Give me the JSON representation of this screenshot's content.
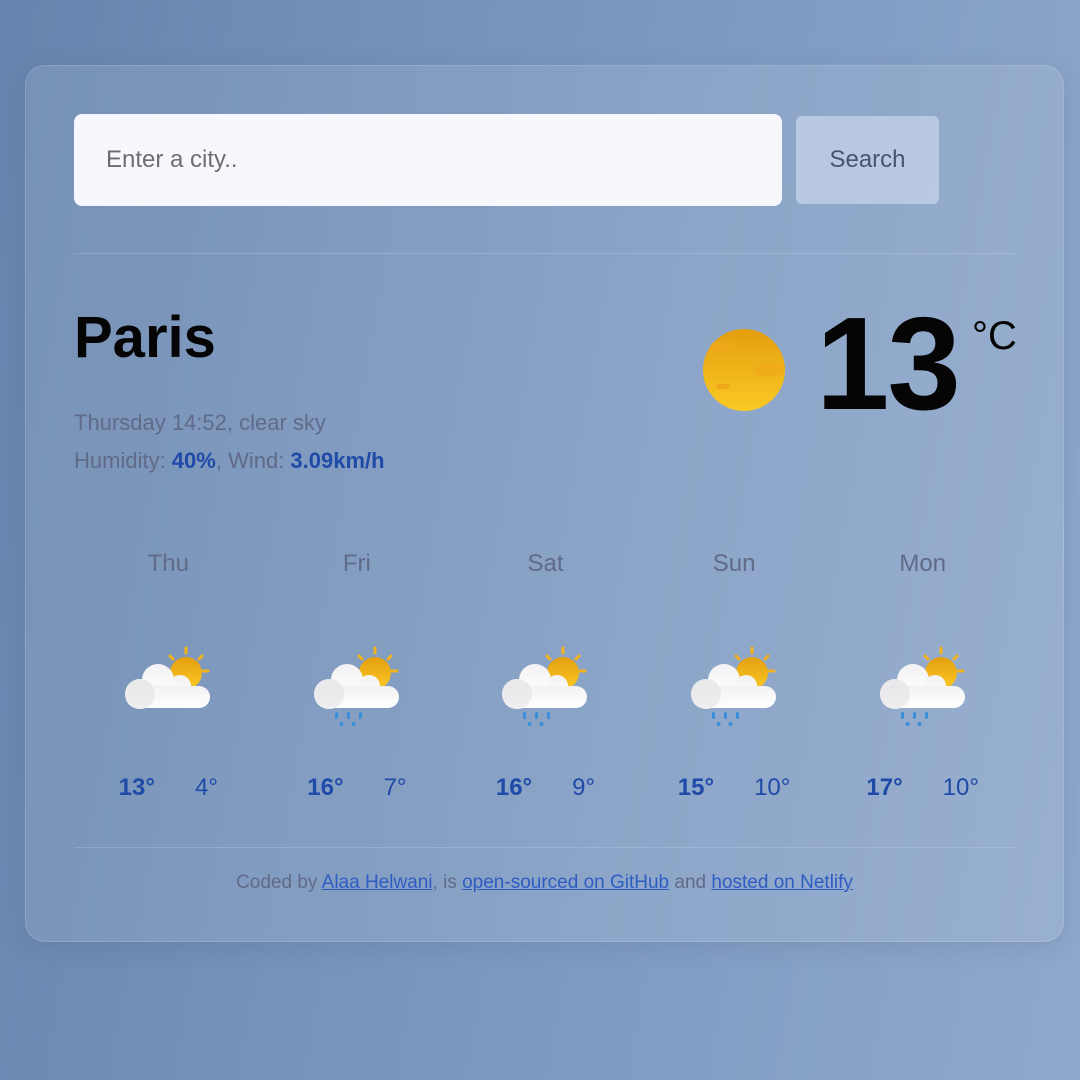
{
  "search": {
    "placeholder": "Enter a city..",
    "value": "",
    "button_label": "Search"
  },
  "current": {
    "city": "Paris",
    "description_line": "Thursday 14:52, clear sky",
    "humidity_label": "Humidity: ",
    "humidity_value": "40%",
    "wind_label": ", Wind: ",
    "wind_value": "3.09km/h",
    "temperature": "13",
    "unit": "°C",
    "icon": "clear-sky-sun-icon"
  },
  "forecast": [
    {
      "day": "Thu",
      "icon": "partly-cloudy-icon",
      "high": "13°",
      "low": "4°"
    },
    {
      "day": "Fri",
      "icon": "partly-cloudy-rain-icon",
      "high": "16°",
      "low": "7°"
    },
    {
      "day": "Sat",
      "icon": "partly-cloudy-rain-icon",
      "high": "16°",
      "low": "9°"
    },
    {
      "day": "Sun",
      "icon": "partly-cloudy-rain-icon",
      "high": "15°",
      "low": "10°"
    },
    {
      "day": "Mon",
      "icon": "partly-cloudy-rain-icon",
      "high": "17°",
      "low": "10°"
    }
  ],
  "footer": {
    "prefix": "Coded by ",
    "author_link": "Alaa Helwani",
    "middle": ", is ",
    "github_link": "open-sourced on GitHub",
    "and": " and ",
    "netlify_link": "hosted on Netlify"
  },
  "colors": {
    "accent": "#1f4aa8",
    "link": "#2f5cc4",
    "muted": "#5f6b88",
    "sun": "#f5b81a"
  }
}
